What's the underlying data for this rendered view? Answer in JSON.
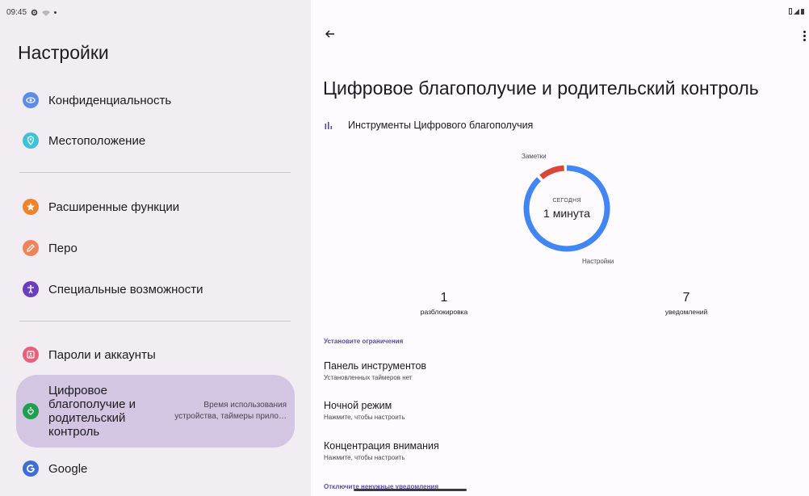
{
  "status_bar": {
    "time": "09:45"
  },
  "sidebar": {
    "title": "Настройки",
    "items": [
      {
        "label": "Конфиденциальность",
        "icon": "eye-icon",
        "color": "#5c8de8"
      },
      {
        "label": "Местоположение",
        "icon": "location-icon",
        "color": "#3fc1d6"
      },
      {
        "label": "Расширенные функции",
        "icon": "star-icon",
        "color": "#f0832d"
      },
      {
        "label": "Перо",
        "icon": "pen-icon",
        "color": "#f0835a"
      },
      {
        "label": "Специальные возможности",
        "icon": "accessibility-icon",
        "color": "#6a3fbf"
      },
      {
        "label": "Пароли и аккаунты",
        "icon": "account-icon",
        "color": "#e8617a"
      },
      {
        "label": "Цифровое благополучие и родительский контроль",
        "sublabel": "Время использования устройства, таймеры прило…",
        "icon": "wellbeing-icon",
        "color": "#1e9e4e"
      },
      {
        "label": "Google",
        "icon": "google-icon",
        "color": "#3c6fd6"
      }
    ]
  },
  "main": {
    "title": "Цифровое благополучие и родительский контроль",
    "tools_label": "Инструменты Цифрового благополучия",
    "donut": {
      "today_label": "СЕГОДНЯ",
      "time_label": "1 минута",
      "segments": [
        {
          "name": "Настройки",
          "fraction": 0.89,
          "color": "#4285f4"
        },
        {
          "name": "Заметки",
          "fraction": 0.11,
          "color": "#db4437"
        }
      ]
    },
    "stats": [
      {
        "value": "1",
        "label": "разблокировка"
      },
      {
        "value": "7",
        "label": "уведомлений"
      }
    ],
    "section_limits": "Установите ограничения",
    "prefs": [
      {
        "title": "Панель инструментов",
        "subtitle": "Установленных таймеров нет"
      },
      {
        "title": "Ночной режим",
        "subtitle": "Нажмите, чтобы настроить"
      },
      {
        "title": "Концентрация внимания",
        "subtitle": "Нажмите, чтобы настроить"
      }
    ],
    "section_notifications": "Отключите ненужные уведомления"
  }
}
